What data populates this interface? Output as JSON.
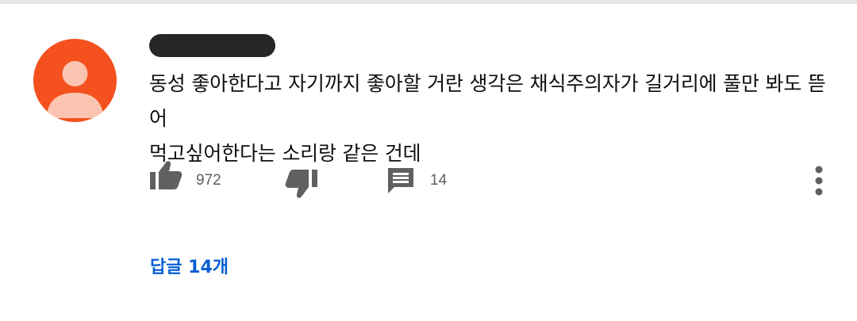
{
  "comment": {
    "author_name_redacted": true,
    "text_line1": "동성 좋아한다고 자기까지 좋아할 거란 생각은 채식주의자가 길거리에 풀만 봐도 뜯어",
    "text_line2": "먹고싶어한다는 소리랑 같은 건데",
    "avatar_color": "#f4511e"
  },
  "actions": {
    "like_icon": "thumbs-up-icon",
    "like_count": "972",
    "dislike_icon": "thumbs-down-icon",
    "reply_icon": "comment-icon",
    "reply_count": "14",
    "more_icon": "more-vertical-icon"
  },
  "replies": {
    "label": "답글 14개",
    "link_color": "#065fd4"
  }
}
